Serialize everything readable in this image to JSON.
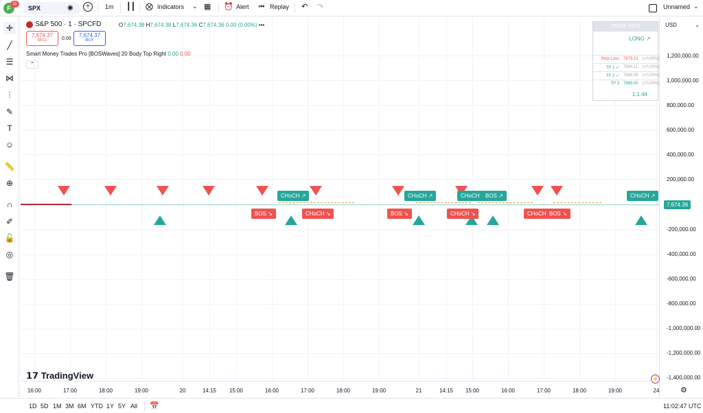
{
  "toolbar": {
    "symbol": "SPX",
    "interval": "1m",
    "indicators": "Indicators",
    "alert": "Alert",
    "replay": "Replay",
    "layout_name": "Unnamed",
    "avatar_letter": "F",
    "notifications": "11"
  },
  "legend": {
    "symbol_title": "S&P 500 · 1 · SPCFD",
    "o_label": "O",
    "o": "7,674.38",
    "h_label": "H",
    "h": "7,674.38",
    "l_label": "L",
    "l": "7,674.36",
    "c_label": "C",
    "c": "7,674.36",
    "change": "0.00 (0.00%)",
    "sell_price": "7,674.37",
    "sell_label": "SELL",
    "spread": "0.00",
    "buy_price": "7,674.37",
    "buy_label": "BUY",
    "indicator_name": "Smart Money Trades Pro [BOSWaves] 20 Body Top Right",
    "ind_v1": "0.00",
    "ind_v2": "0.00"
  },
  "trade_info": {
    "title": "TRADE INFO",
    "direction": "LONG ↗",
    "rows": [
      {
        "label": "Stop Loss",
        "value": "7679.21",
        "pct": "(+0.00%)"
      },
      {
        "label": "TP 1 ✓",
        "value": "7684.11",
        "pct": "(+0.00%)"
      },
      {
        "label": "TP 2 ✓",
        "value": "7686.06",
        "pct": "(+0.00%)"
      },
      {
        "label": "TP 3",
        "value": "7689.00",
        "pct": "(+0.00%)"
      }
    ],
    "rr": "1:1.44"
  },
  "price_axis": {
    "currency": "USD",
    "labels": [
      "1,200,000.00",
      "1,000,000.00",
      "800,000.00",
      "600,000.00",
      "400,000.00",
      "200,000.00",
      "-200,000.00",
      "-400,000.00",
      "-600,000.00",
      "-800,000.00",
      "-1,000,000.00",
      "-1,200,000.00",
      "-1,400,000.00"
    ],
    "current_price": "7,674.36"
  },
  "time_axis": {
    "labels": [
      "16:00",
      "17:00",
      "18:00",
      "19:00",
      "20",
      "14:15",
      "15:00",
      "16:00",
      "17:00",
      "18:00",
      "19:00",
      "21",
      "14:15",
      "15:00",
      "16:00",
      "17:00",
      "18:00",
      "19:00",
      "24"
    ]
  },
  "markers": {
    "bos": "BOS ↘",
    "choch_down": "CHoCH ↘",
    "choch_up": "CHoCH ↗",
    "bos_up": "BOS ↗"
  },
  "bottom": {
    "ranges": [
      "1D",
      "5D",
      "1M",
      "3M",
      "6M",
      "YTD",
      "1Y",
      "5Y",
      "All"
    ],
    "clock": "11:02:47 UTC"
  },
  "brand": "TradingView",
  "colors": {
    "up": "#26a69a",
    "down": "#ef5350",
    "accent": "#2962ff"
  }
}
